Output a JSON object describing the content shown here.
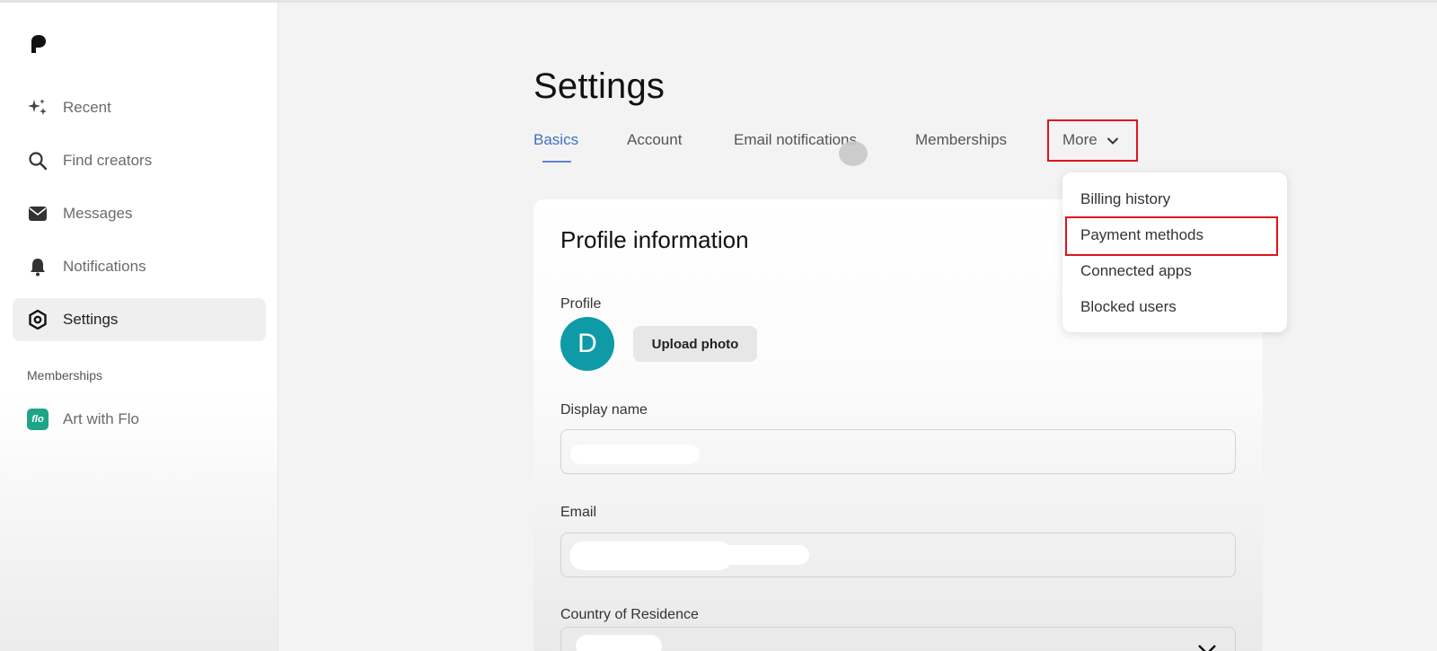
{
  "sidebar": {
    "items": [
      {
        "label": "Recent",
        "icon": "sparkle-icon"
      },
      {
        "label": "Find creators",
        "icon": "search-icon"
      },
      {
        "label": "Messages",
        "icon": "envelope-icon"
      },
      {
        "label": "Notifications",
        "icon": "bell-icon"
      },
      {
        "label": "Settings",
        "icon": "gear-icon",
        "active": true
      }
    ],
    "section_label": "Memberships",
    "memberships": [
      {
        "label": "Art with Flo",
        "badge": "flo"
      }
    ]
  },
  "main": {
    "title": "Settings",
    "tabs": [
      {
        "label": "Basics",
        "active": true
      },
      {
        "label": "Account"
      },
      {
        "label": "Email notifications"
      },
      {
        "label": "Memberships"
      },
      {
        "label": "More"
      }
    ],
    "more_menu": {
      "items": [
        "Billing history",
        "Payment methods",
        "Connected apps",
        "Blocked users"
      ],
      "highlighted": "Payment methods"
    },
    "profile_card": {
      "title": "Profile information",
      "profile_label": "Profile",
      "avatar_letter": "D",
      "upload_label": "Upload photo",
      "display_name_label": "Display name",
      "email_label": "Email",
      "country_label": "Country of Residence"
    }
  },
  "colors": {
    "accent": "#3f6fc6",
    "highlight_box": "#e0141a",
    "avatar_bg": "#0f9aa8",
    "flo_badge": "#1ea587"
  }
}
